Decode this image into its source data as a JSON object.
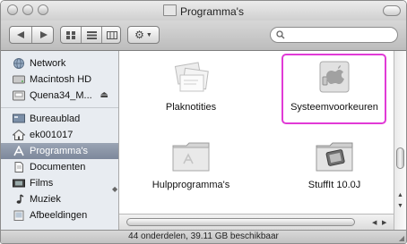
{
  "window": {
    "title": "Programma's"
  },
  "toolbar": {
    "back_icon": "back-arrow-icon",
    "forward_icon": "forward-arrow-icon",
    "view_modes": [
      "icon-view",
      "list-view",
      "column-view"
    ],
    "action_icon": "gear-icon",
    "search_icon": "magnifier-icon",
    "search_value": ""
  },
  "sidebar": {
    "devices": [
      {
        "label": "Network",
        "icon": "globe-icon"
      },
      {
        "label": "Macintosh HD",
        "icon": "hard-disk-icon"
      },
      {
        "label": "Quena34_M...",
        "icon": "disk-icon",
        "eject": "⏏"
      }
    ],
    "places": [
      {
        "label": "Bureaublad",
        "icon": "desktop-icon"
      },
      {
        "label": "ek001017",
        "icon": "home-icon"
      },
      {
        "label": "Programma's",
        "icon": "applications-icon",
        "selected": true
      },
      {
        "label": "Documenten",
        "icon": "documents-icon"
      },
      {
        "label": "Films",
        "icon": "films-icon"
      },
      {
        "label": "Muziek",
        "icon": "music-icon"
      },
      {
        "label": "Afbeeldingen",
        "icon": "pictures-icon"
      }
    ]
  },
  "content": {
    "items": [
      {
        "label": "Plaknotities",
        "icon": "sticky-notes-icon"
      },
      {
        "label": "Systeemvoorkeuren",
        "icon": "system-preferences-icon",
        "highlighted": true
      },
      {
        "label": "Hulpprogramma's",
        "icon": "folder-icon"
      },
      {
        "label": "StuffIt 10.0J",
        "icon": "stuffit-folder-icon"
      }
    ],
    "highlight_color": "#e13ad6"
  },
  "status": {
    "text": "44 onderdelen, 39.11 GB beschikbaar"
  }
}
